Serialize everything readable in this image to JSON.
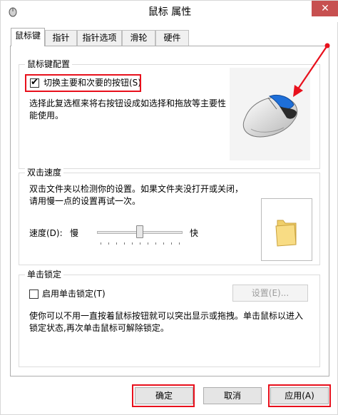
{
  "window": {
    "title": "鼠标 属性",
    "close_glyph": "✕"
  },
  "tabs": [
    {
      "label": "鼠标键"
    },
    {
      "label": "指针"
    },
    {
      "label": "指针选项"
    },
    {
      "label": "滑轮"
    },
    {
      "label": "硬件"
    }
  ],
  "button_config": {
    "group_label": "鼠标键配置",
    "swap_checkbox_label": "切换主要和次要的按钮(S)",
    "swap_checked": true,
    "description": "选择此复选框来将右按钮设成如选择和拖放等主要性能使用。"
  },
  "double_click": {
    "group_label": "双击速度",
    "description": "双击文件夹以检测你的设置。如果文件夹没打开或关闭，请用慢一点的设置再试一次。",
    "speed_label": "速度(D):",
    "slow_label": "慢",
    "fast_label": "快",
    "speed_level": 0.5
  },
  "click_lock": {
    "group_label": "单击锁定",
    "checkbox_label": "启用单击锁定(T)",
    "checked": false,
    "settings_button": "设置(E)...",
    "description": "使你可以不用一直按着鼠标按钮就可以突出显示或拖拽。单击鼠标以进入锁定状态,再次单击鼠标可解除锁定。"
  },
  "footer": {
    "ok": "确定",
    "cancel": "取消",
    "apply": "应用(A)"
  },
  "colors": {
    "annotation_red": "#e8101c",
    "close_red": "#c75050",
    "mouse_blue": "#1e6fd9"
  }
}
